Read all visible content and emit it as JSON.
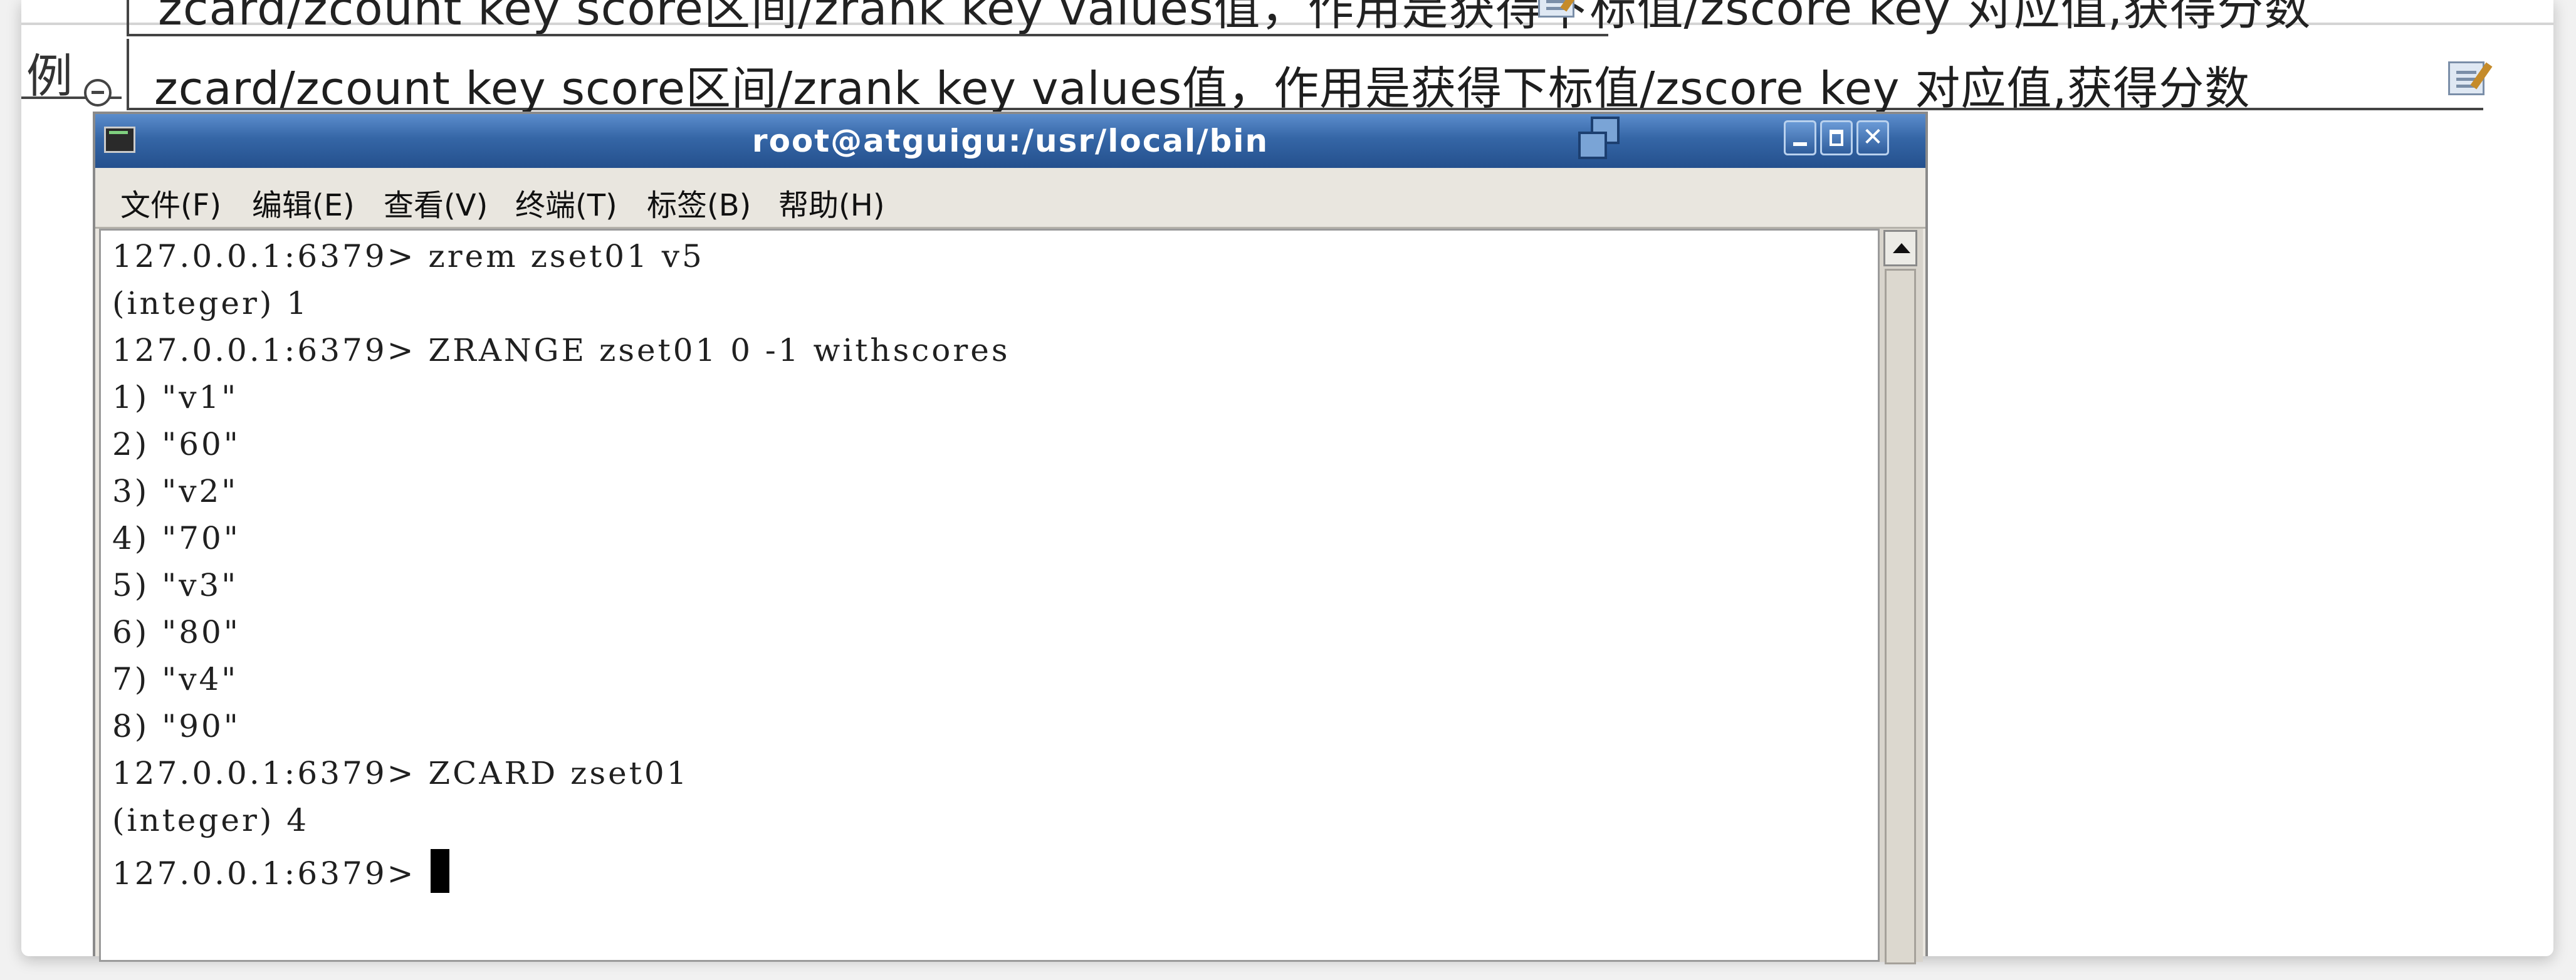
{
  "document": {
    "previous_line_text": "zcard/zcount key score区间/zrank key values值，作用是获得下标值/zscore key 对应值,获得分数",
    "row_label": "例",
    "note_text": "zcard/zcount key score区间/zrank key values值，作用是获得下标值/zscore key 对应值,获得分数"
  },
  "terminal": {
    "title": "root@atguigu:/usr/local/bin",
    "menu": [
      "文件(F)",
      "编辑(E)",
      "查看(V)",
      "终端(T)",
      "标签(B)",
      "帮助(H)"
    ],
    "lines": [
      "127.0.0.1:6379> zrem zset01 v5",
      "(integer) 1",
      "127.0.0.1:6379> ZRANGE zset01 0 -1 withscores",
      "1) \"v1\"",
      "2) \"60\"",
      "3) \"v2\"",
      "4) \"70\"",
      "5) \"v3\"",
      "6) \"80\"",
      "7) \"v4\"",
      "8) \"90\"",
      "127.0.0.1:6379> ZCARD zset01",
      "(integer) 4"
    ],
    "prompt": "127.0.0.1:6379> "
  },
  "icons": {
    "title": "terminal-app-icon",
    "stack": "window-stack-icon",
    "minimize": "minimize-icon",
    "maximize": "maximize-icon",
    "close": "close-icon",
    "note_edit": "edit-note-icon",
    "collapse": "collapse-icon"
  },
  "colors": {
    "titlebar": "#3566a6",
    "terminal_bg": "#ffffff",
    "terminal_text": "#202020",
    "window_chrome": "#e9e6df"
  }
}
